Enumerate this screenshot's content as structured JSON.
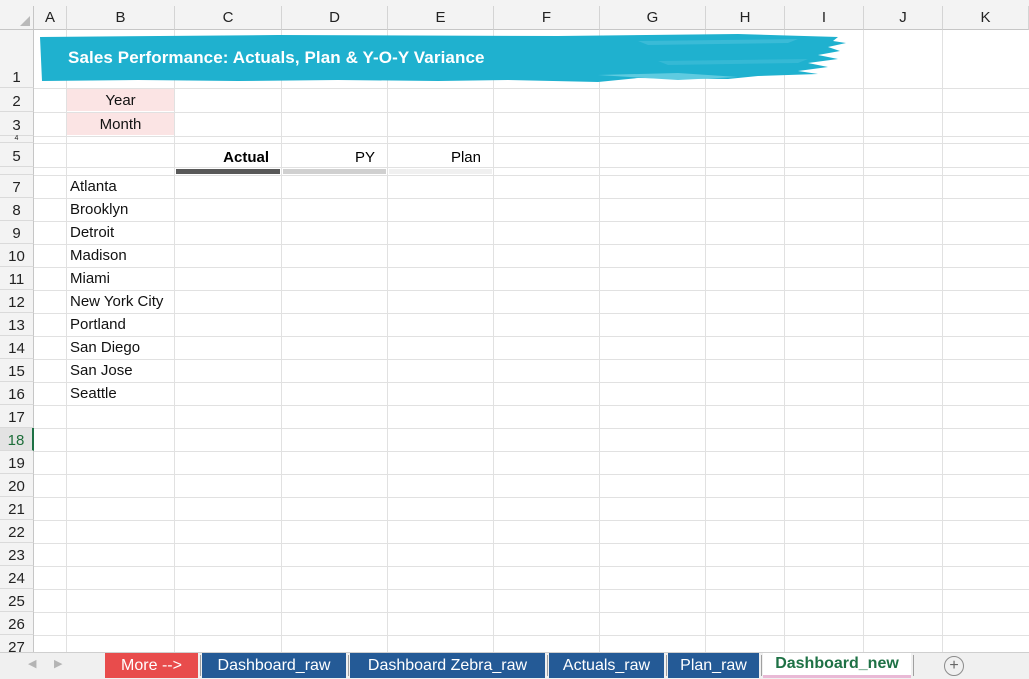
{
  "columns": [
    "A",
    "B",
    "C",
    "D",
    "E",
    "F",
    "G",
    "H",
    "I",
    "J",
    "K"
  ],
  "rows": [
    "1",
    "2",
    "3",
    "4",
    "5",
    "7",
    "8",
    "9",
    "10",
    "11",
    "12",
    "13",
    "14",
    "15",
    "16",
    "17",
    "18",
    "19",
    "20",
    "21",
    "22",
    "23",
    "24",
    "25",
    "26",
    "27"
  ],
  "active_row": "18",
  "title": "Sales Performance: Actuals, Plan & Y-O-Y Variance",
  "filters": {
    "year": "Year",
    "month": "Month"
  },
  "headers": {
    "actual": "Actual",
    "py": "PY",
    "plan": "Plan"
  },
  "cities": [
    "Atlanta",
    "Brooklyn",
    "Detroit",
    "Madison",
    "Miami",
    "New York City",
    "Portland",
    "San Diego",
    "San Jose",
    "Seattle"
  ],
  "tabs": [
    {
      "label": "More -->",
      "color": "#e84c4c"
    },
    {
      "label": "Dashboard_raw",
      "color": "#245a96"
    },
    {
      "label": "Dashboard Zebra_raw",
      "color": "#245a96"
    },
    {
      "label": "Actuals_raw",
      "color": "#245a96"
    },
    {
      "label": "Plan_raw",
      "color": "#245a96"
    },
    {
      "label": "Dashboard_new",
      "color": "#ffffff"
    }
  ],
  "colors": {
    "banner": "#1fb1cf",
    "filter_fill": "#fbe4e4",
    "actual_bar": "#595959",
    "py_bar": "#d0d0d0",
    "plan_bar": "#f0f0f0"
  },
  "icons": {
    "add_sheet": "plus-circle-icon",
    "prev": "chevron-left-icon",
    "next": "chevron-right-icon"
  }
}
